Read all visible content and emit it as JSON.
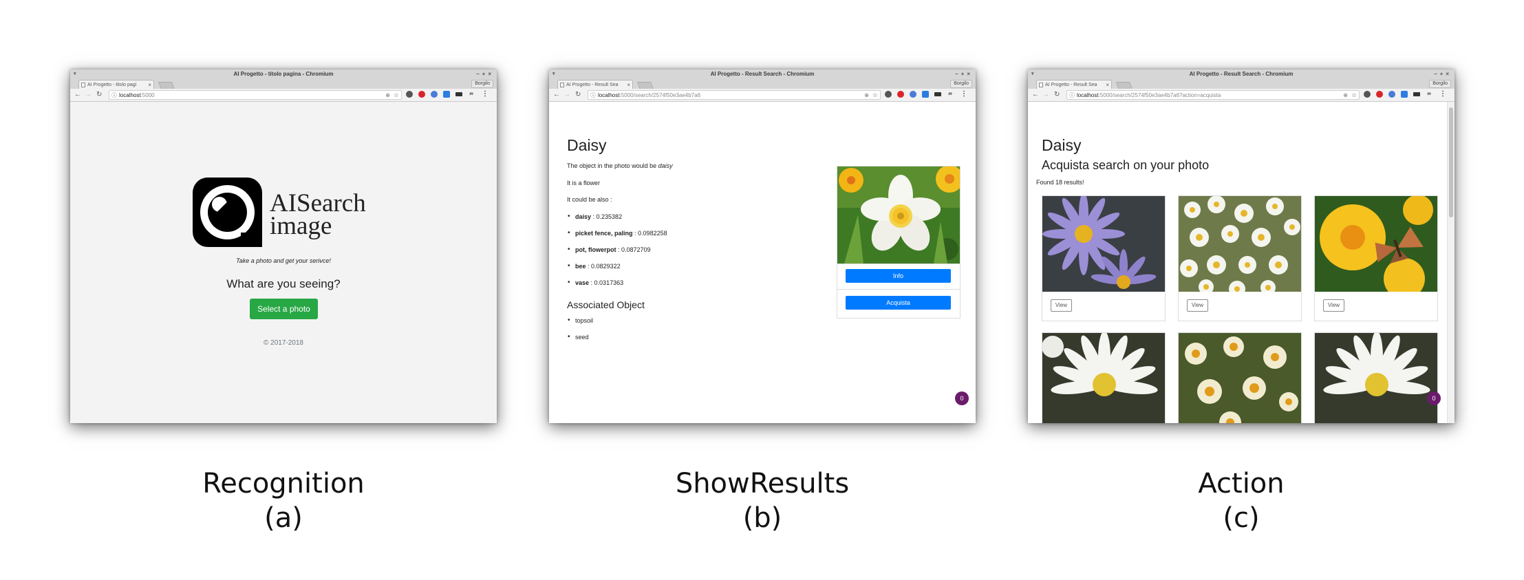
{
  "panels": [
    {
      "window_title": "AI Progetto - titolo pagina - Chromium",
      "tab_label": "AI Progetto - titolo pagi",
      "profile": "Borgilo",
      "url_host": "localhost",
      "url_path": ":5000",
      "logo": {
        "line1": "AISearch",
        "line2": "image"
      },
      "tagline": "Take a photo and get your serivce!",
      "question": "What are you seeing?",
      "select_button": "Select a photo",
      "copyright": "© 2017-2018",
      "caption_title": "Recognition",
      "caption_letter": "(a)"
    },
    {
      "window_title": "AI Progetto - Result Search - Chromium",
      "tab_label": "AI Progetto - Result Sea",
      "profile": "Borgilo",
      "url_host": "localhost",
      "url_path": ":5000/search/2574f50e3ae4b7a6",
      "heading": "Daisy",
      "sentence_prefix": "The object in the photo would be ",
      "sentence_object": "daisy",
      "flower_line": "It is a flower",
      "also_line": "It could be also :",
      "predictions": [
        {
          "label": "daisy",
          "score": "0.235382"
        },
        {
          "label": "picket fence, paling",
          "score": "0.0982258"
        },
        {
          "label": "pot, flowerpot",
          "score": "0.0872709"
        },
        {
          "label": "bee",
          "score": "0.0829322"
        },
        {
          "label": "vase",
          "score": "0.0317363"
        }
      ],
      "associated_heading": "Associated Object",
      "associated": [
        "topsoil",
        "seed"
      ],
      "info_button": "Info",
      "acquista_button": "Acquista",
      "chat_count": "0",
      "caption_title": "ShowResults",
      "caption_letter": "(b)"
    },
    {
      "window_title": "AI Progetto - Result Search - Chromium",
      "tab_label": "AI Progetto - Result Sea",
      "profile": "Borgilo",
      "url_host": "localhost",
      "url_path": ":5000/search/2574f50e3ae4b7a6?action=acquista",
      "heading": "Daisy",
      "subheading": "Acquista search on your photo",
      "found": "Found 18 results!",
      "view_label": "View",
      "chat_count": "0",
      "caption_title": "Action",
      "caption_letter": "(c)"
    }
  ],
  "colors": {
    "primary": "#007bff",
    "success": "#28a745",
    "chat": "#6a1b6b",
    "muted": "#6c757d"
  }
}
